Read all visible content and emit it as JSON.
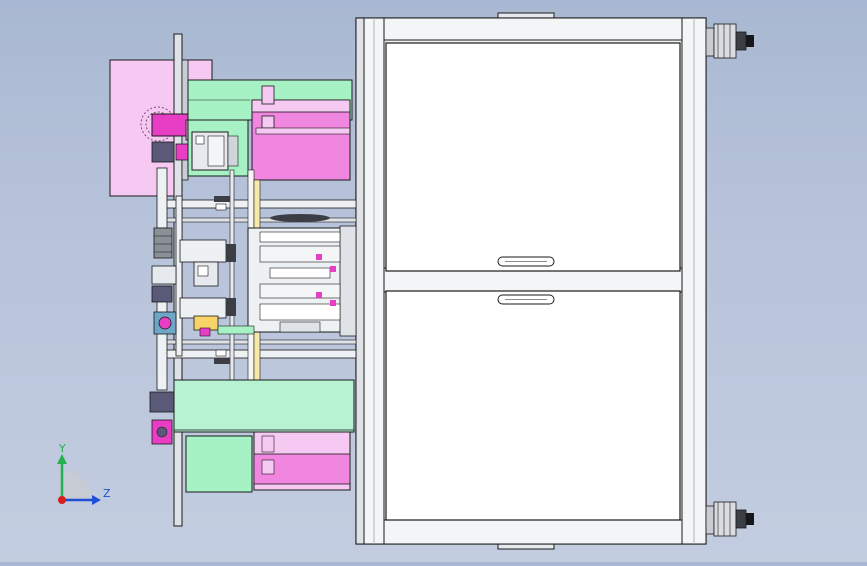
{
  "viewport": {
    "background_top": "#a9b8d2",
    "background_bottom": "#c3cde0"
  },
  "model": {
    "part_colors": {
      "pink": "#f6c9f3",
      "magenta": "#f086e0",
      "hot_pink": "#e83ec6",
      "green": "#a6f2c4",
      "mint": "#b7f2d3",
      "steel": "#d8dde6",
      "frame": "#eef1f4",
      "outline": "#1a1a1a"
    },
    "components": [
      "main-frame",
      "upper-door-panel",
      "lower-door-panel",
      "left-mounting-plate",
      "upper-pink-block",
      "upper-green-slide",
      "lower-green-slide",
      "center-mechanism",
      "guide-rods",
      "leveling-feet"
    ]
  },
  "triad": {
    "y_label": "Y",
    "z_label": "Z",
    "y_color": "#22b14c",
    "z_color": "#1f4fd6",
    "origin_color": "#d81e1e"
  }
}
